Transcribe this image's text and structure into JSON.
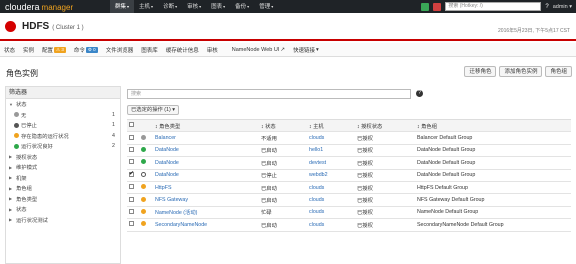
{
  "colors": {
    "topbar": "#1f2327",
    "brand_accent": "#f0a31f",
    "alert_red": "#d40000",
    "link": "#2a6bb5",
    "gray_dot": "#999999",
    "green_dot": "#2ea84a",
    "orange_dot": "#f0a31f",
    "sq_green": "#3aa757",
    "sq_red": "#d04040"
  },
  "topbar": {
    "logo_main": "cloudera",
    "logo_sub": "manager",
    "nav": [
      "群集",
      "主机",
      "诊断",
      "审核",
      "图表",
      "备份",
      "管理"
    ],
    "search_placeholder": "搜索 (Hotkey: /)",
    "user": "admin"
  },
  "service": {
    "name": "HDFS",
    "cluster": "( Cluster 1 )",
    "timestamp": "2016年5月23日, 下午5点17 CST"
  },
  "tabs": {
    "status": "状态",
    "instances": "实例",
    "config": "配置",
    "config_badge": "3",
    "commands": "命令",
    "commands_badge": "0",
    "file_browser": "文件浏览器",
    "charts": "图表库",
    "cache_stats": "缓存统计信息",
    "audit": "审核",
    "nn_web": "NameNode Web UI",
    "quick_links": "快速链接"
  },
  "page": {
    "title": "角色实例",
    "btn_migrate": "迁移角色",
    "btn_add": "添加角色实例",
    "btn_groups": "角色组"
  },
  "filters": {
    "header": "筛选器",
    "status_label": "状态",
    "status_items": [
      {
        "label": "无",
        "count": "1",
        "color": "#999999"
      },
      {
        "label": "已停止",
        "count": "1",
        "color": "#555555"
      },
      {
        "label": "存在隐患的运行状况",
        "count": "4",
        "color": "#f0a31f"
      },
      {
        "label": "运行状况良好",
        "count": "2",
        "color": "#2ea84a"
      }
    ],
    "groups": [
      "授权状态",
      "维护模式",
      "机架",
      "角色组",
      "角色类型",
      "状态",
      "运行状况测试"
    ]
  },
  "table": {
    "search_placeholder": "搜索",
    "action_button": "已选定的操作 (1)",
    "headers": [
      "角色类型",
      "状态",
      "主机",
      "授权状态",
      "角色组"
    ],
    "rows": [
      {
        "checked": false,
        "dot": "#999999",
        "type": "Balancer",
        "state": "不适用",
        "host": "clouds",
        "auth": "已授权",
        "group": "Balancer Default Group"
      },
      {
        "checked": false,
        "dot": "#2ea84a",
        "type": "DataNode",
        "state": "已启动",
        "host": "hello1",
        "auth": "已授权",
        "group": "DataNode Default Group"
      },
      {
        "checked": false,
        "dot": "#2ea84a",
        "type": "DataNode",
        "state": "已启动",
        "host": "devtest",
        "auth": "已授权",
        "group": "DataNode Default Group"
      },
      {
        "checked": true,
        "dot": "stopped",
        "type": "DataNode",
        "state": "已停止",
        "host": "webdb2",
        "auth": "已授权",
        "group": "DataNode Default Group"
      },
      {
        "checked": false,
        "dot": "#f0a31f",
        "type": "HttpFS",
        "state": "已启动",
        "host": "clouds",
        "auth": "已授权",
        "group": "HttpFS Default Group"
      },
      {
        "checked": false,
        "dot": "#f0a31f",
        "type": "NFS Gateway",
        "state": "已启动",
        "host": "clouds",
        "auth": "已授权",
        "group": "NFS Gateway Default Group"
      },
      {
        "checked": false,
        "dot": "#f0a31f",
        "type": "NameNode (活动)",
        "state": "忙碌",
        "host": "clouds",
        "auth": "已授权",
        "group": "NameNode Default Group"
      },
      {
        "checked": false,
        "dot": "#f0a31f",
        "type": "SecondaryNameNode",
        "state": "已启动",
        "host": "clouds",
        "auth": "已授权",
        "group": "SecondaryNameNode Default Group"
      }
    ]
  }
}
